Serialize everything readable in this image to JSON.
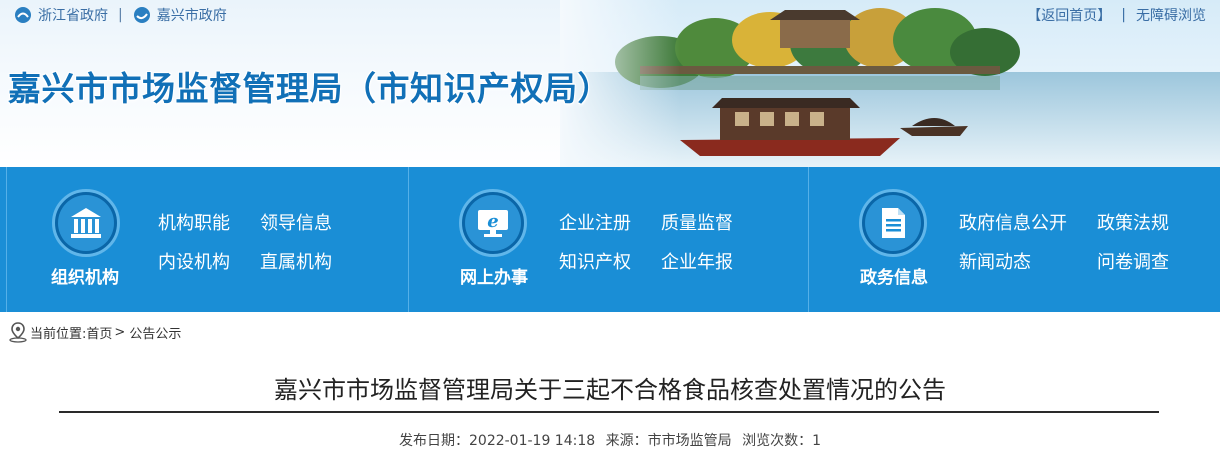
{
  "top_links": {
    "province": "浙江省政府",
    "separator": "|",
    "city": "嘉兴市政府"
  },
  "top_right": {
    "home": "【返回首页】",
    "separator": "|",
    "accessibility": "无障碍浏览"
  },
  "site_title": "嘉兴市市场监督管理局（市知识产权局）",
  "colors": {
    "nav_blue": "#1a8ed6",
    "title_blue": "#1170b7",
    "link_blue": "#3a6ea5"
  },
  "nav": [
    {
      "category": "组织机构",
      "icon": "building-columns-icon",
      "links": [
        "机构职能",
        "领导信息",
        "内设机构",
        "直属机构"
      ]
    },
    {
      "category": "网上办事",
      "icon": "computer-e-icon",
      "links": [
        "企业注册",
        "质量监督",
        "知识产权",
        "企业年报"
      ]
    },
    {
      "category": "政务信息",
      "icon": "document-icon",
      "links": [
        "政府信息公开",
        "政策法规",
        "新闻动态",
        "问卷调查"
      ]
    }
  ],
  "breadcrumb": {
    "prefix": "当前位置:",
    "home": "首页",
    "gt": ">",
    "current": "公告公示"
  },
  "article": {
    "title": "嘉兴市市场监督管理局关于三起不合格食品核查处置情况的公告",
    "date_label": "发布日期：",
    "date": "2022-01-19 14:18",
    "source_label": "来源：",
    "source": "市市场监管局",
    "views_label": "浏览次数：",
    "views": "1"
  }
}
